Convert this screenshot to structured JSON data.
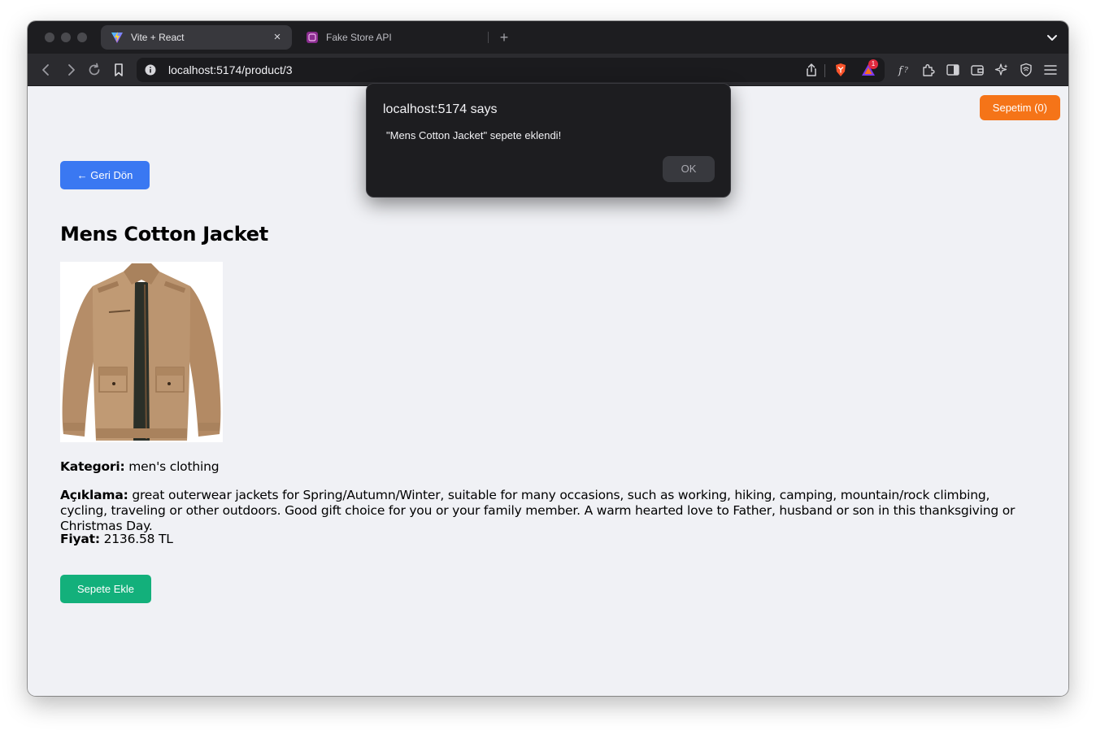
{
  "browser": {
    "tabs": [
      {
        "title": "Vite + React",
        "active": true,
        "close_glyph": "×"
      },
      {
        "title": "Fake Store API",
        "active": false
      }
    ],
    "new_tab_glyph": "+",
    "url": "localhost:5174/product/3",
    "extension_badge_count": "1"
  },
  "page": {
    "cart_button_label": "Sepetim (0)",
    "back_button_label": "← Geri Dön",
    "product": {
      "title": "Mens Cotton Jacket",
      "category_label": "Kategori:",
      "category_value": "men's clothing",
      "description_label": "Açıklama:",
      "description_value": "great outerwear jackets for Spring/Autumn/Winter, suitable for many occasions, such as working, hiking, camping, mountain/rock climbing, cycling, traveling or other outdoors. Good gift choice for you or your family member. A warm hearted love to Father, husband or son in this thanksgiving or Christmas Day.",
      "price_label": "Fiyat:",
      "price_value": "2136.58 TL"
    },
    "add_to_cart_label": "Sepete Ekle"
  },
  "dialog": {
    "title": "localhost:5174 says",
    "message": "\"Mens Cotton Jacket\" sepete eklendi!",
    "ok_label": "OK"
  },
  "colors": {
    "cart_button": "#f57418",
    "back_button": "#3a78f2",
    "add_button": "#13b07b",
    "page_background": "#f0f1f5",
    "browser_chrome": "#1d1d20"
  }
}
